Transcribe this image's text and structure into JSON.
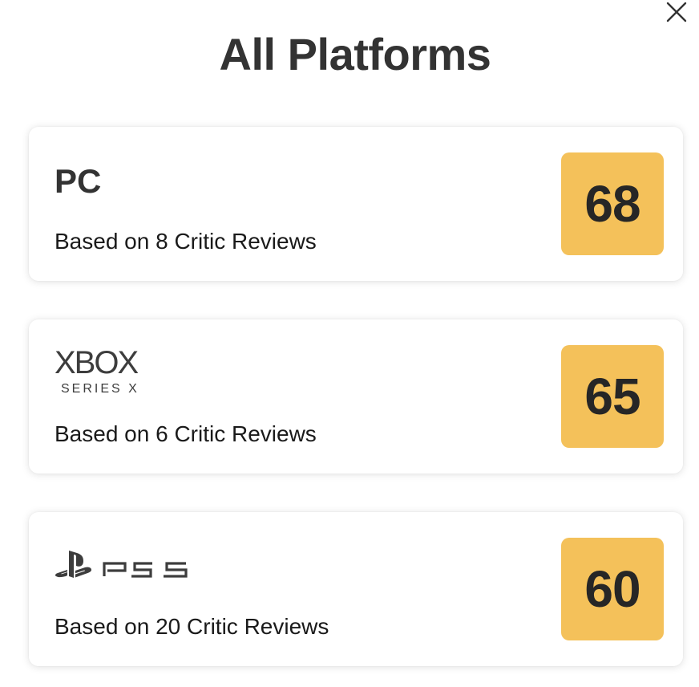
{
  "dialog": {
    "title": "All Platforms",
    "close_icon": "close-icon"
  },
  "colors": {
    "score_mixed": "#f4c15a",
    "card_bg": "#ffffff",
    "text": "#262626"
  },
  "platforms": [
    {
      "name": "PC",
      "logo": "",
      "reviews_text": "Based on 8 Critic Reviews",
      "score": "68"
    },
    {
      "name": "XBOX",
      "logo": "xbox-series-x-logo",
      "logo_sub": "SERIES X",
      "reviews_text": "Based on 6 Critic Reviews",
      "score": "65"
    },
    {
      "name": "",
      "logo": "ps5-logo",
      "reviews_text": "Based on 20 Critic Reviews",
      "score": "60"
    }
  ]
}
